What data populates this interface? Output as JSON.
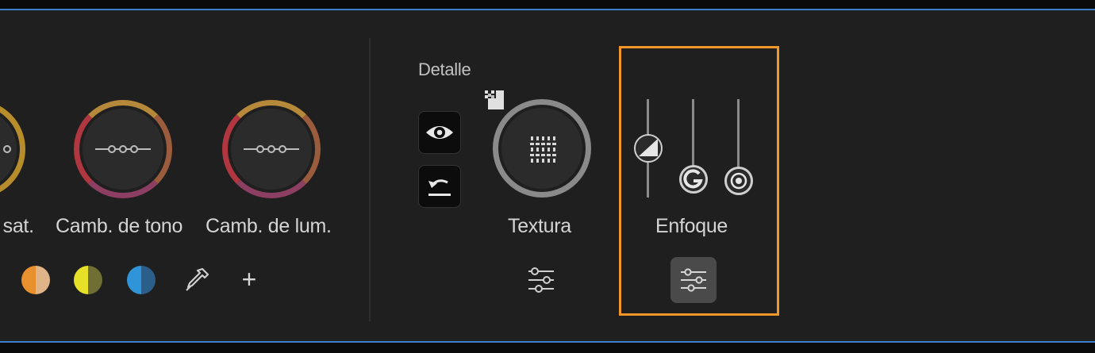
{
  "wheels": [
    {
      "label": "Camb. de sat.",
      "ring_color": "#b78d2c"
    },
    {
      "label": "Camb. de tono",
      "ring_color": "#a8634a"
    },
    {
      "label": "Camb. de lum.",
      "ring_color": "#a8634a"
    }
  ],
  "swatches": [
    {
      "name": "orange",
      "left": "#e8902e",
      "right": "#e0b489"
    },
    {
      "name": "yellow",
      "left": "#e6e028",
      "right": "#6f6f33"
    },
    {
      "name": "blue",
      "left": "#2f95d8",
      "right": "#2b5f8a"
    }
  ],
  "tools": {
    "eyedropper_icon": "eyedropper-icon",
    "add_icon": "plus-icon",
    "add_label": "+"
  },
  "detalle": {
    "section_title": "Detalle",
    "texture_label": "Textura",
    "sharpen_label": "Enfoque"
  },
  "colors": {
    "highlight": "#f0962a",
    "accent_border": "#3d7fcf"
  }
}
